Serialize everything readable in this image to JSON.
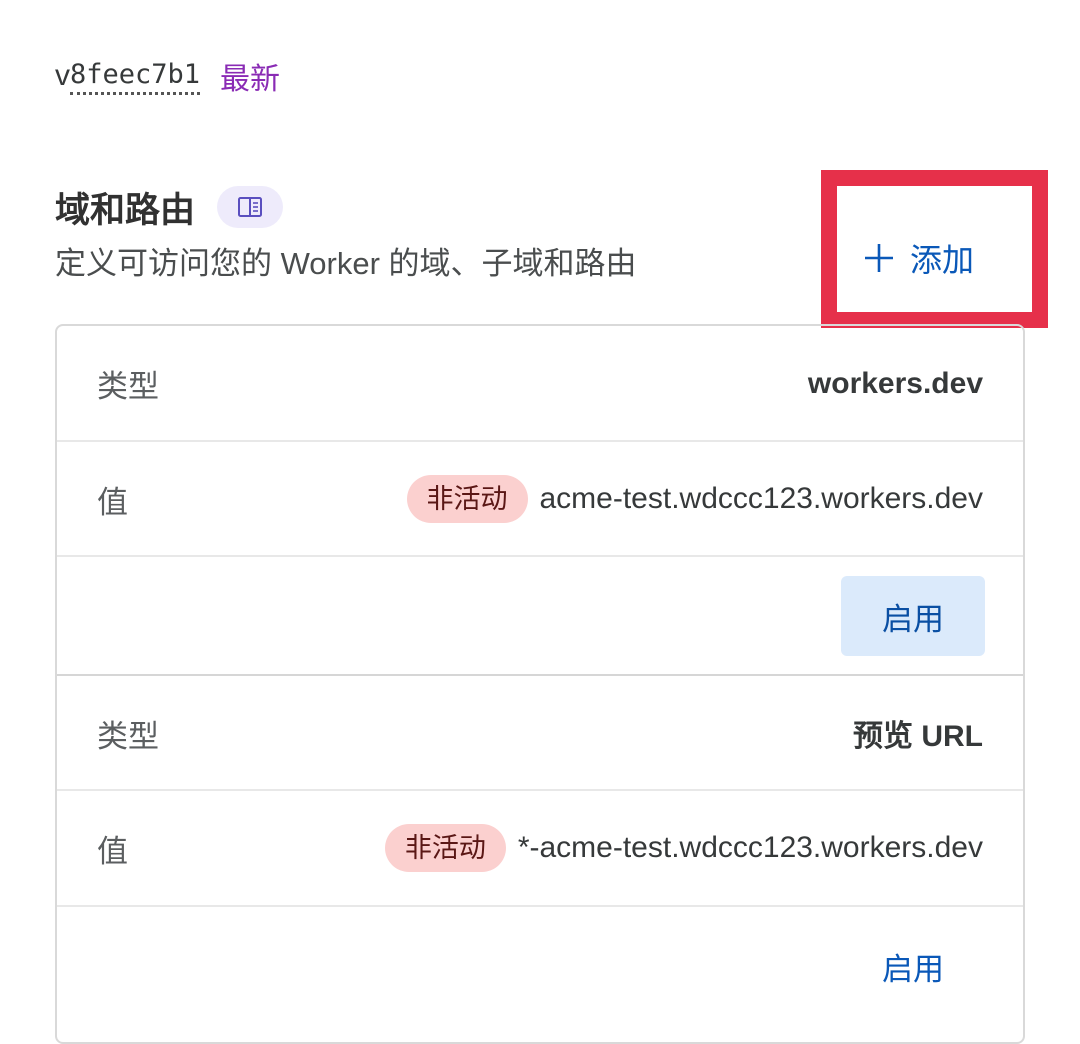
{
  "version": {
    "prefix": "v",
    "hash": "8feec7b1",
    "latest_label": "最新"
  },
  "section": {
    "title": "域和路由",
    "docs_icon": "book-icon",
    "description": "定义可访问您的 Worker 的域、子域和路由",
    "add_label": "添加",
    "add_icon": "plus-icon",
    "highlight_color": "#e6304a"
  },
  "routes": [
    {
      "type_label": "类型",
      "type_value": "workers.dev",
      "value_label": "值",
      "status": "非活动",
      "url": "acme-test.wdccc123.workers.dev",
      "action_label": "启用"
    },
    {
      "type_label": "类型",
      "type_value": "预览 URL",
      "value_label": "值",
      "status": "非活动",
      "url": "*-acme-test.wdccc123.workers.dev",
      "action_label": "启用"
    }
  ]
}
